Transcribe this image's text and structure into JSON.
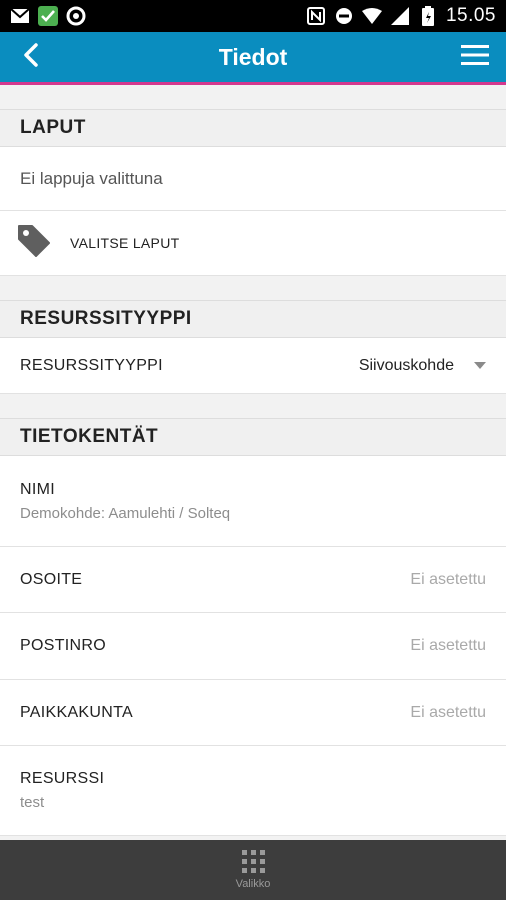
{
  "status_bar": {
    "time": "15.05",
    "icons": [
      "gmail-icon",
      "check-icon",
      "record-icon",
      "nfc-icon",
      "dnd-icon",
      "wifi-icon",
      "signal-icon",
      "battery-icon"
    ]
  },
  "app_bar": {
    "title": "Tiedot",
    "color": "#0a8dbf",
    "accent": "#d4388e"
  },
  "tags_section": {
    "header": "LAPUT",
    "empty_text": "Ei lappuja valittuna",
    "select_button_label": "VALITSE LAPUT"
  },
  "resource_type_section": {
    "header": "RESURSSITYYPPI",
    "field_label": "RESURSSITYYPPI",
    "selected_value": "Siivouskohde"
  },
  "fields_section": {
    "header": "TIETOKENTÄT",
    "fields": [
      {
        "label": "NIMI",
        "value": "Demokohde: Aamulehti / Solteq"
      },
      {
        "label": "OSOITE",
        "value": "Ei asetettu"
      },
      {
        "label": "POSTINRO",
        "value": "Ei asetettu"
      },
      {
        "label": "PAIKKAKUNTA",
        "value": "Ei asetettu"
      },
      {
        "label": "RESURSSI",
        "value": "test"
      }
    ]
  },
  "bottom_bar": {
    "label": "Valikko"
  }
}
